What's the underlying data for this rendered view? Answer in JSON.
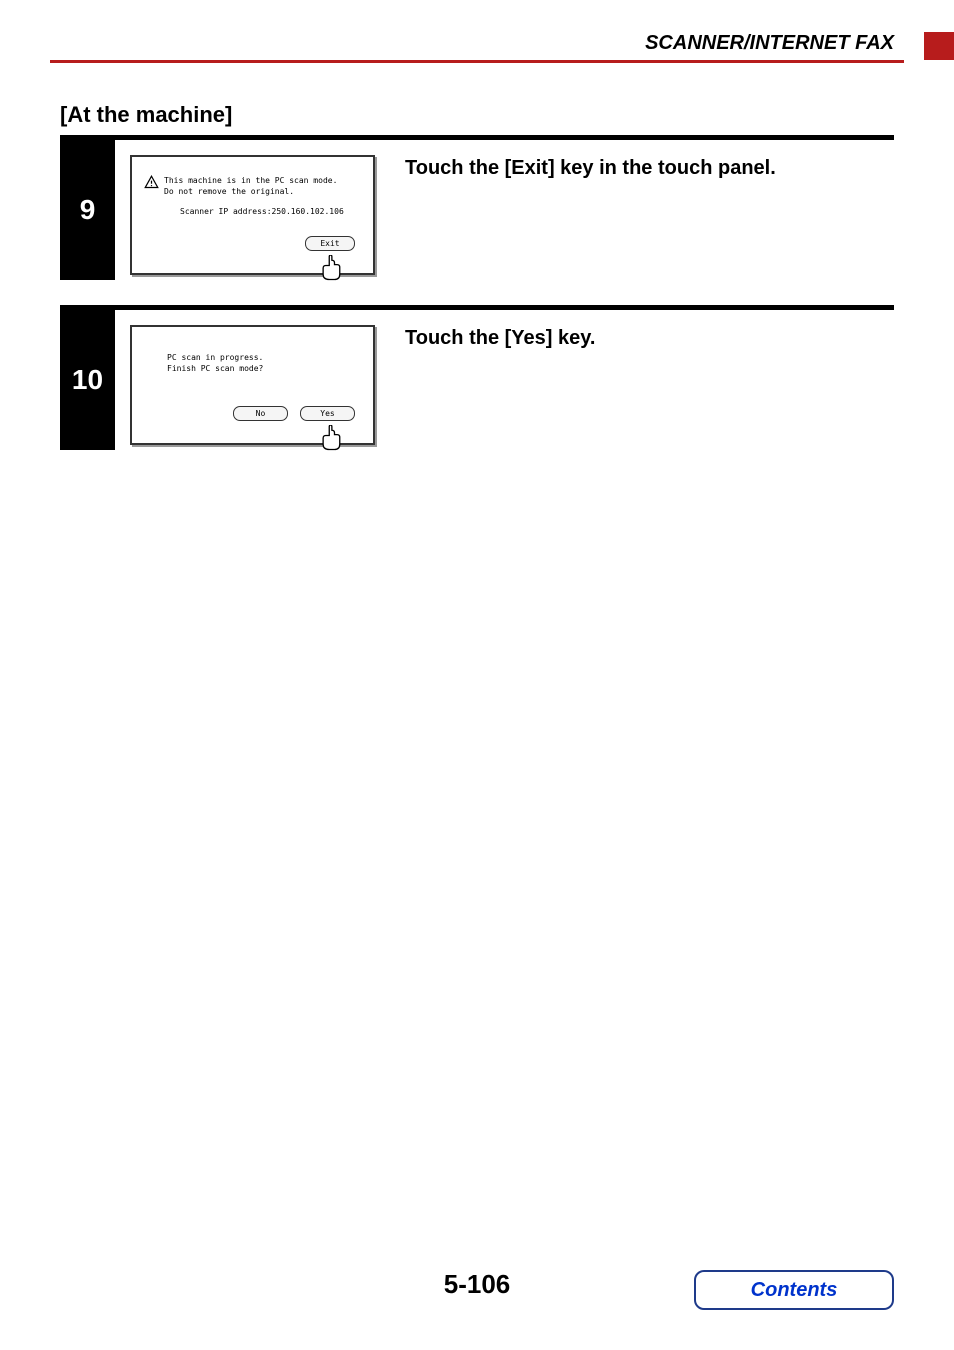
{
  "header": {
    "section_title": "SCANNER/INTERNET FAX"
  },
  "subtitle": "[At the machine]",
  "steps": {
    "step9": {
      "number": "9",
      "instruction": "Touch the [Exit] key in the touch panel.",
      "screen": {
        "line1": "This machine is in the PC scan mode.",
        "line2": "Do not remove the original.",
        "ip_line": "Scanner IP address:250.160.102.106",
        "exit_label": "Exit"
      }
    },
    "step10": {
      "number": "10",
      "instruction": "Touch the [Yes] key.",
      "screen": {
        "line1": "PC scan in progress.",
        "line2": "Finish PC scan mode?",
        "no_label": "No",
        "yes_label": "Yes"
      }
    }
  },
  "footer": {
    "page_number": "5-106",
    "contents_label": "Contents"
  }
}
